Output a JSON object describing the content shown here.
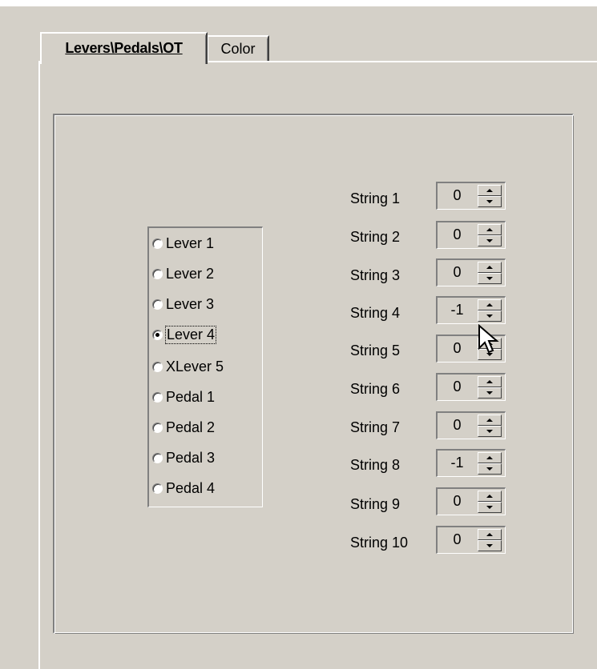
{
  "tabs": [
    {
      "label": "Levers\\Pedals\\OT",
      "active": true
    },
    {
      "label": "Color",
      "active": false
    }
  ],
  "radio_options": [
    {
      "label": "Lever 1",
      "checked": false
    },
    {
      "label": "Lever 2",
      "checked": false
    },
    {
      "label": "Lever 3",
      "checked": false
    },
    {
      "label": "Lever 4",
      "checked": true
    },
    {
      "label": "XLever 5",
      "checked": false
    },
    {
      "label": "Pedal 1",
      "checked": false
    },
    {
      "label": "Pedal 2",
      "checked": false
    },
    {
      "label": "Pedal 3",
      "checked": false
    },
    {
      "label": "Pedal 4",
      "checked": false
    }
  ],
  "strings": [
    {
      "label": "String 1",
      "value": "0"
    },
    {
      "label": "String 2",
      "value": "0"
    },
    {
      "label": "String 3",
      "value": "0"
    },
    {
      "label": "String 4",
      "value": "-1"
    },
    {
      "label": "String 5",
      "value": "0"
    },
    {
      "label": "String 6",
      "value": "0"
    },
    {
      "label": "String 7",
      "value": "0"
    },
    {
      "label": "String 8",
      "value": "-1"
    },
    {
      "label": "String 9",
      "value": "0"
    },
    {
      "label": "String 10",
      "value": "0"
    }
  ],
  "colors": {
    "face": "#d4d0c8",
    "highlight": "#ffffff",
    "shadow": "#808080",
    "dark_shadow": "#404040"
  }
}
